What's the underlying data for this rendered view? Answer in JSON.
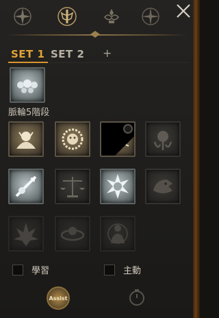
{
  "top_tabs": [
    {
      "icon": "star-compass-icon"
    },
    {
      "icon": "sword-emblem-icon"
    },
    {
      "icon": "ornate-crest-icon"
    },
    {
      "icon": "compass-rose-icon"
    }
  ],
  "close_icon": "close-icon",
  "sets": {
    "set1": "SET 1",
    "set2": "SET 2",
    "add": "+"
  },
  "section_label": "脈輪5階段",
  "skills_top": [
    {
      "icon": "orb-cluster-icon"
    }
  ],
  "skills_grid": [
    {
      "icon": "demon-bust-icon",
      "style": "gold"
    },
    {
      "icon": "lion-head-icon",
      "style": "gold"
    },
    {
      "icon": "spider-icon",
      "style": "gold",
      "cooldown": true
    },
    {
      "icon": "skull-tentacles-icon",
      "style": "dark"
    },
    {
      "icon": "spear-strike-icon",
      "style": "silver"
    },
    {
      "icon": "balance-scale-icon",
      "style": "dark"
    },
    {
      "icon": "shield-burst-icon",
      "style": "silver"
    },
    {
      "icon": "dragon-head-icon",
      "style": "dark"
    },
    {
      "icon": "flame-burst-icon",
      "style": "dark"
    },
    {
      "icon": "orbit-ring-icon",
      "style": "dark"
    },
    {
      "icon": "meditating-figure-icon",
      "style": "dark"
    }
  ],
  "checkboxes": {
    "learn": "學習",
    "active": "主動"
  },
  "bottom": {
    "assist": "Assist"
  },
  "colors": {
    "accent": "#e2a336",
    "background": "#1e1d1b"
  }
}
